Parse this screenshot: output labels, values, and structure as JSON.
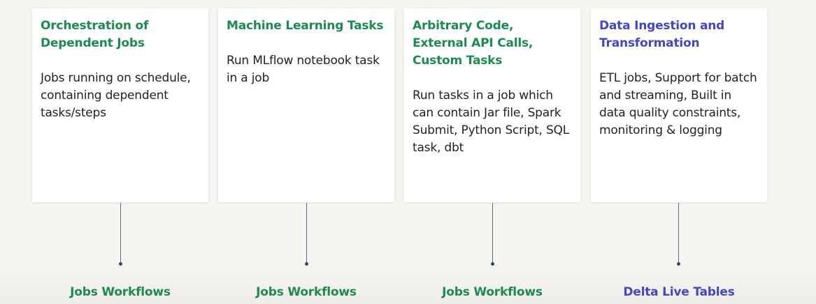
{
  "cards": [
    {
      "title": "Orchestration of Dependent Jobs",
      "body": "Jobs running on schedule, containing dependent tasks/steps",
      "label": "Jobs Workflows",
      "accent": "#1d8a4f"
    },
    {
      "title": "Machine Learning Tasks",
      "body": "Run MLflow notebook task in a job",
      "label": "Jobs Workflows",
      "accent": "#1d8a4f"
    },
    {
      "title": "Arbitrary Code, External API Calls, Custom Tasks",
      "body": "Run tasks in a job which can contain Jar file, Spark Submit, Python Script, SQL task, dbt",
      "label": "Jobs Workflows",
      "accent": "#1d8a4f"
    },
    {
      "title": "Data Ingestion and Transformation",
      "body": "ETL jobs, Support for batch and streaming, Built in data quality constraints, monitoring & logging",
      "label": "Delta Live Tables",
      "accent": "#4247c7"
    }
  ]
}
